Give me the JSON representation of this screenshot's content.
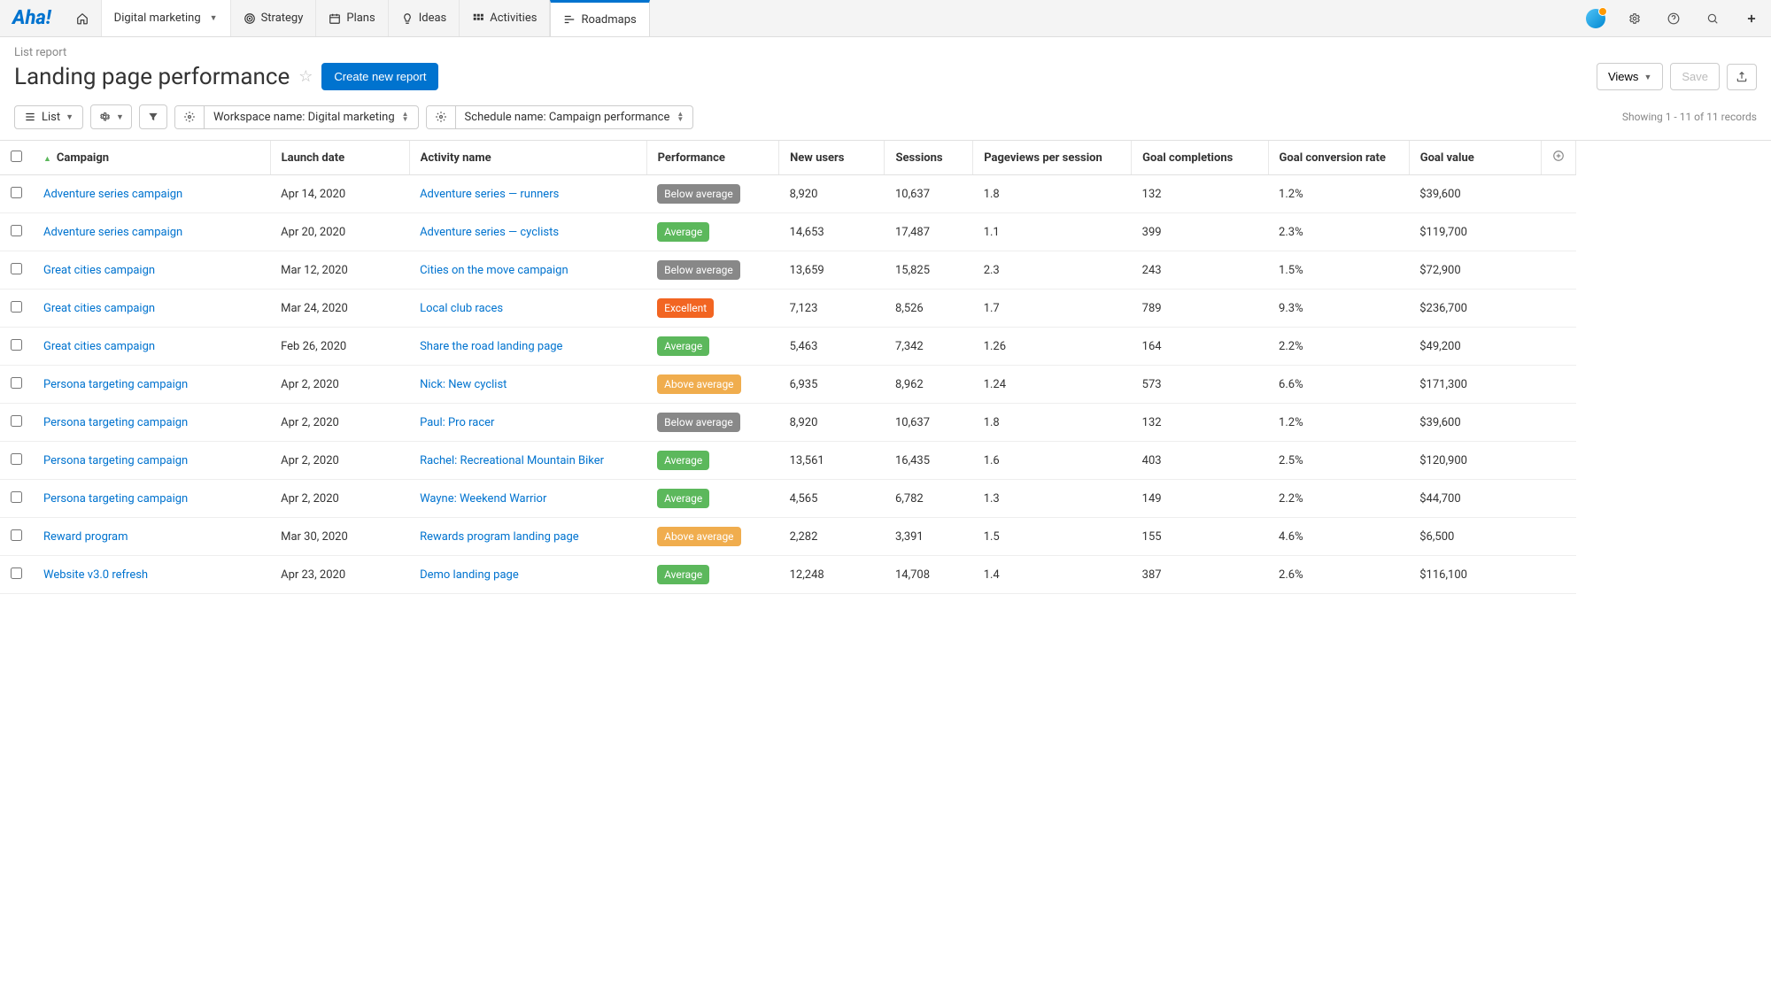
{
  "logo": "Aha!",
  "workspace": "Digital marketing",
  "nav": {
    "strategy": "Strategy",
    "plans": "Plans",
    "ideas": "Ideas",
    "activities": "Activities",
    "roadmaps": "Roadmaps"
  },
  "breadcrumb": "List report",
  "title": "Landing page performance",
  "create_report": "Create new report",
  "views_btn": "Views",
  "save_btn": "Save",
  "list_btn": "List",
  "filter1_label": "Workspace name: Digital marketing",
  "filter2_label": "Schedule name: Campaign performance",
  "records_text": "Showing 1 - 11 of 11 records",
  "columns": {
    "campaign": "Campaign",
    "launch": "Launch date",
    "activity": "Activity name",
    "perf": "Performance",
    "new_users": "New users",
    "sessions": "Sessions",
    "pvs": "Pageviews per session",
    "goal_comp": "Goal completions",
    "goal_conv": "Goal conversion rate",
    "goal_val": "Goal value"
  },
  "perf_labels": {
    "below": "Below average",
    "avg": "Average",
    "above": "Above average",
    "excellent": "Excellent"
  },
  "rows": [
    {
      "campaign": "Adventure series campaign",
      "launch": "Apr 14, 2020",
      "activity": "Adventure series — runners",
      "perf": "below",
      "new_users": "8,920",
      "sessions": "10,637",
      "pvs": "1.8",
      "goal_comp": "132",
      "goal_conv": "1.2%",
      "goal_val": "$39,600"
    },
    {
      "campaign": "Adventure series campaign",
      "launch": "Apr 20, 2020",
      "activity": "Adventure series — cyclists",
      "perf": "avg",
      "new_users": "14,653",
      "sessions": "17,487",
      "pvs": "1.1",
      "goal_comp": "399",
      "goal_conv": "2.3%",
      "goal_val": "$119,700"
    },
    {
      "campaign": "Great cities campaign",
      "launch": "Mar 12, 2020",
      "activity": "Cities on the move campaign",
      "perf": "below",
      "new_users": "13,659",
      "sessions": "15,825",
      "pvs": "2.3",
      "goal_comp": "243",
      "goal_conv": "1.5%",
      "goal_val": "$72,900"
    },
    {
      "campaign": "Great cities campaign",
      "launch": "Mar 24, 2020",
      "activity": "Local club races",
      "perf": "excellent",
      "new_users": "7,123",
      "sessions": "8,526",
      "pvs": "1.7",
      "goal_comp": "789",
      "goal_conv": "9.3%",
      "goal_val": "$236,700"
    },
    {
      "campaign": "Great cities campaign",
      "launch": "Feb 26, 2020",
      "activity": "Share the road landing page",
      "perf": "avg",
      "new_users": "5,463",
      "sessions": "7,342",
      "pvs": "1.26",
      "goal_comp": "164",
      "goal_conv": "2.2%",
      "goal_val": "$49,200"
    },
    {
      "campaign": "Persona targeting campaign",
      "launch": "Apr 2, 2020",
      "activity": "Nick: New cyclist",
      "perf": "above",
      "new_users": "6,935",
      "sessions": "8,962",
      "pvs": "1.24",
      "goal_comp": "573",
      "goal_conv": "6.6%",
      "goal_val": "$171,300"
    },
    {
      "campaign": "Persona targeting campaign",
      "launch": "Apr 2, 2020",
      "activity": "Paul: Pro racer",
      "perf": "below",
      "new_users": "8,920",
      "sessions": "10,637",
      "pvs": "1.8",
      "goal_comp": "132",
      "goal_conv": "1.2%",
      "goal_val": "$39,600"
    },
    {
      "campaign": "Persona targeting campaign",
      "launch": "Apr 2, 2020",
      "activity": "Rachel: Recreational Mountain Biker",
      "perf": "avg",
      "new_users": "13,561",
      "sessions": "16,435",
      "pvs": "1.6",
      "goal_comp": "403",
      "goal_conv": "2.5%",
      "goal_val": "$120,900"
    },
    {
      "campaign": "Persona targeting campaign",
      "launch": "Apr 2, 2020",
      "activity": "Wayne: Weekend Warrior",
      "perf": "avg",
      "new_users": "4,565",
      "sessions": "6,782",
      "pvs": "1.3",
      "goal_comp": "149",
      "goal_conv": "2.2%",
      "goal_val": "$44,700"
    },
    {
      "campaign": "Reward program",
      "launch": "Mar 30, 2020",
      "activity": "Rewards program landing page",
      "perf": "above",
      "new_users": "2,282",
      "sessions": "3,391",
      "pvs": "1.5",
      "goal_comp": "155",
      "goal_conv": "4.6%",
      "goal_val": "$6,500"
    },
    {
      "campaign": "Website v3.0 refresh",
      "launch": "Apr 23, 2020",
      "activity": "Demo landing page",
      "perf": "avg",
      "new_users": "12,248",
      "sessions": "14,708",
      "pvs": "1.4",
      "goal_comp": "387",
      "goal_conv": "2.6%",
      "goal_val": "$116,100"
    }
  ]
}
